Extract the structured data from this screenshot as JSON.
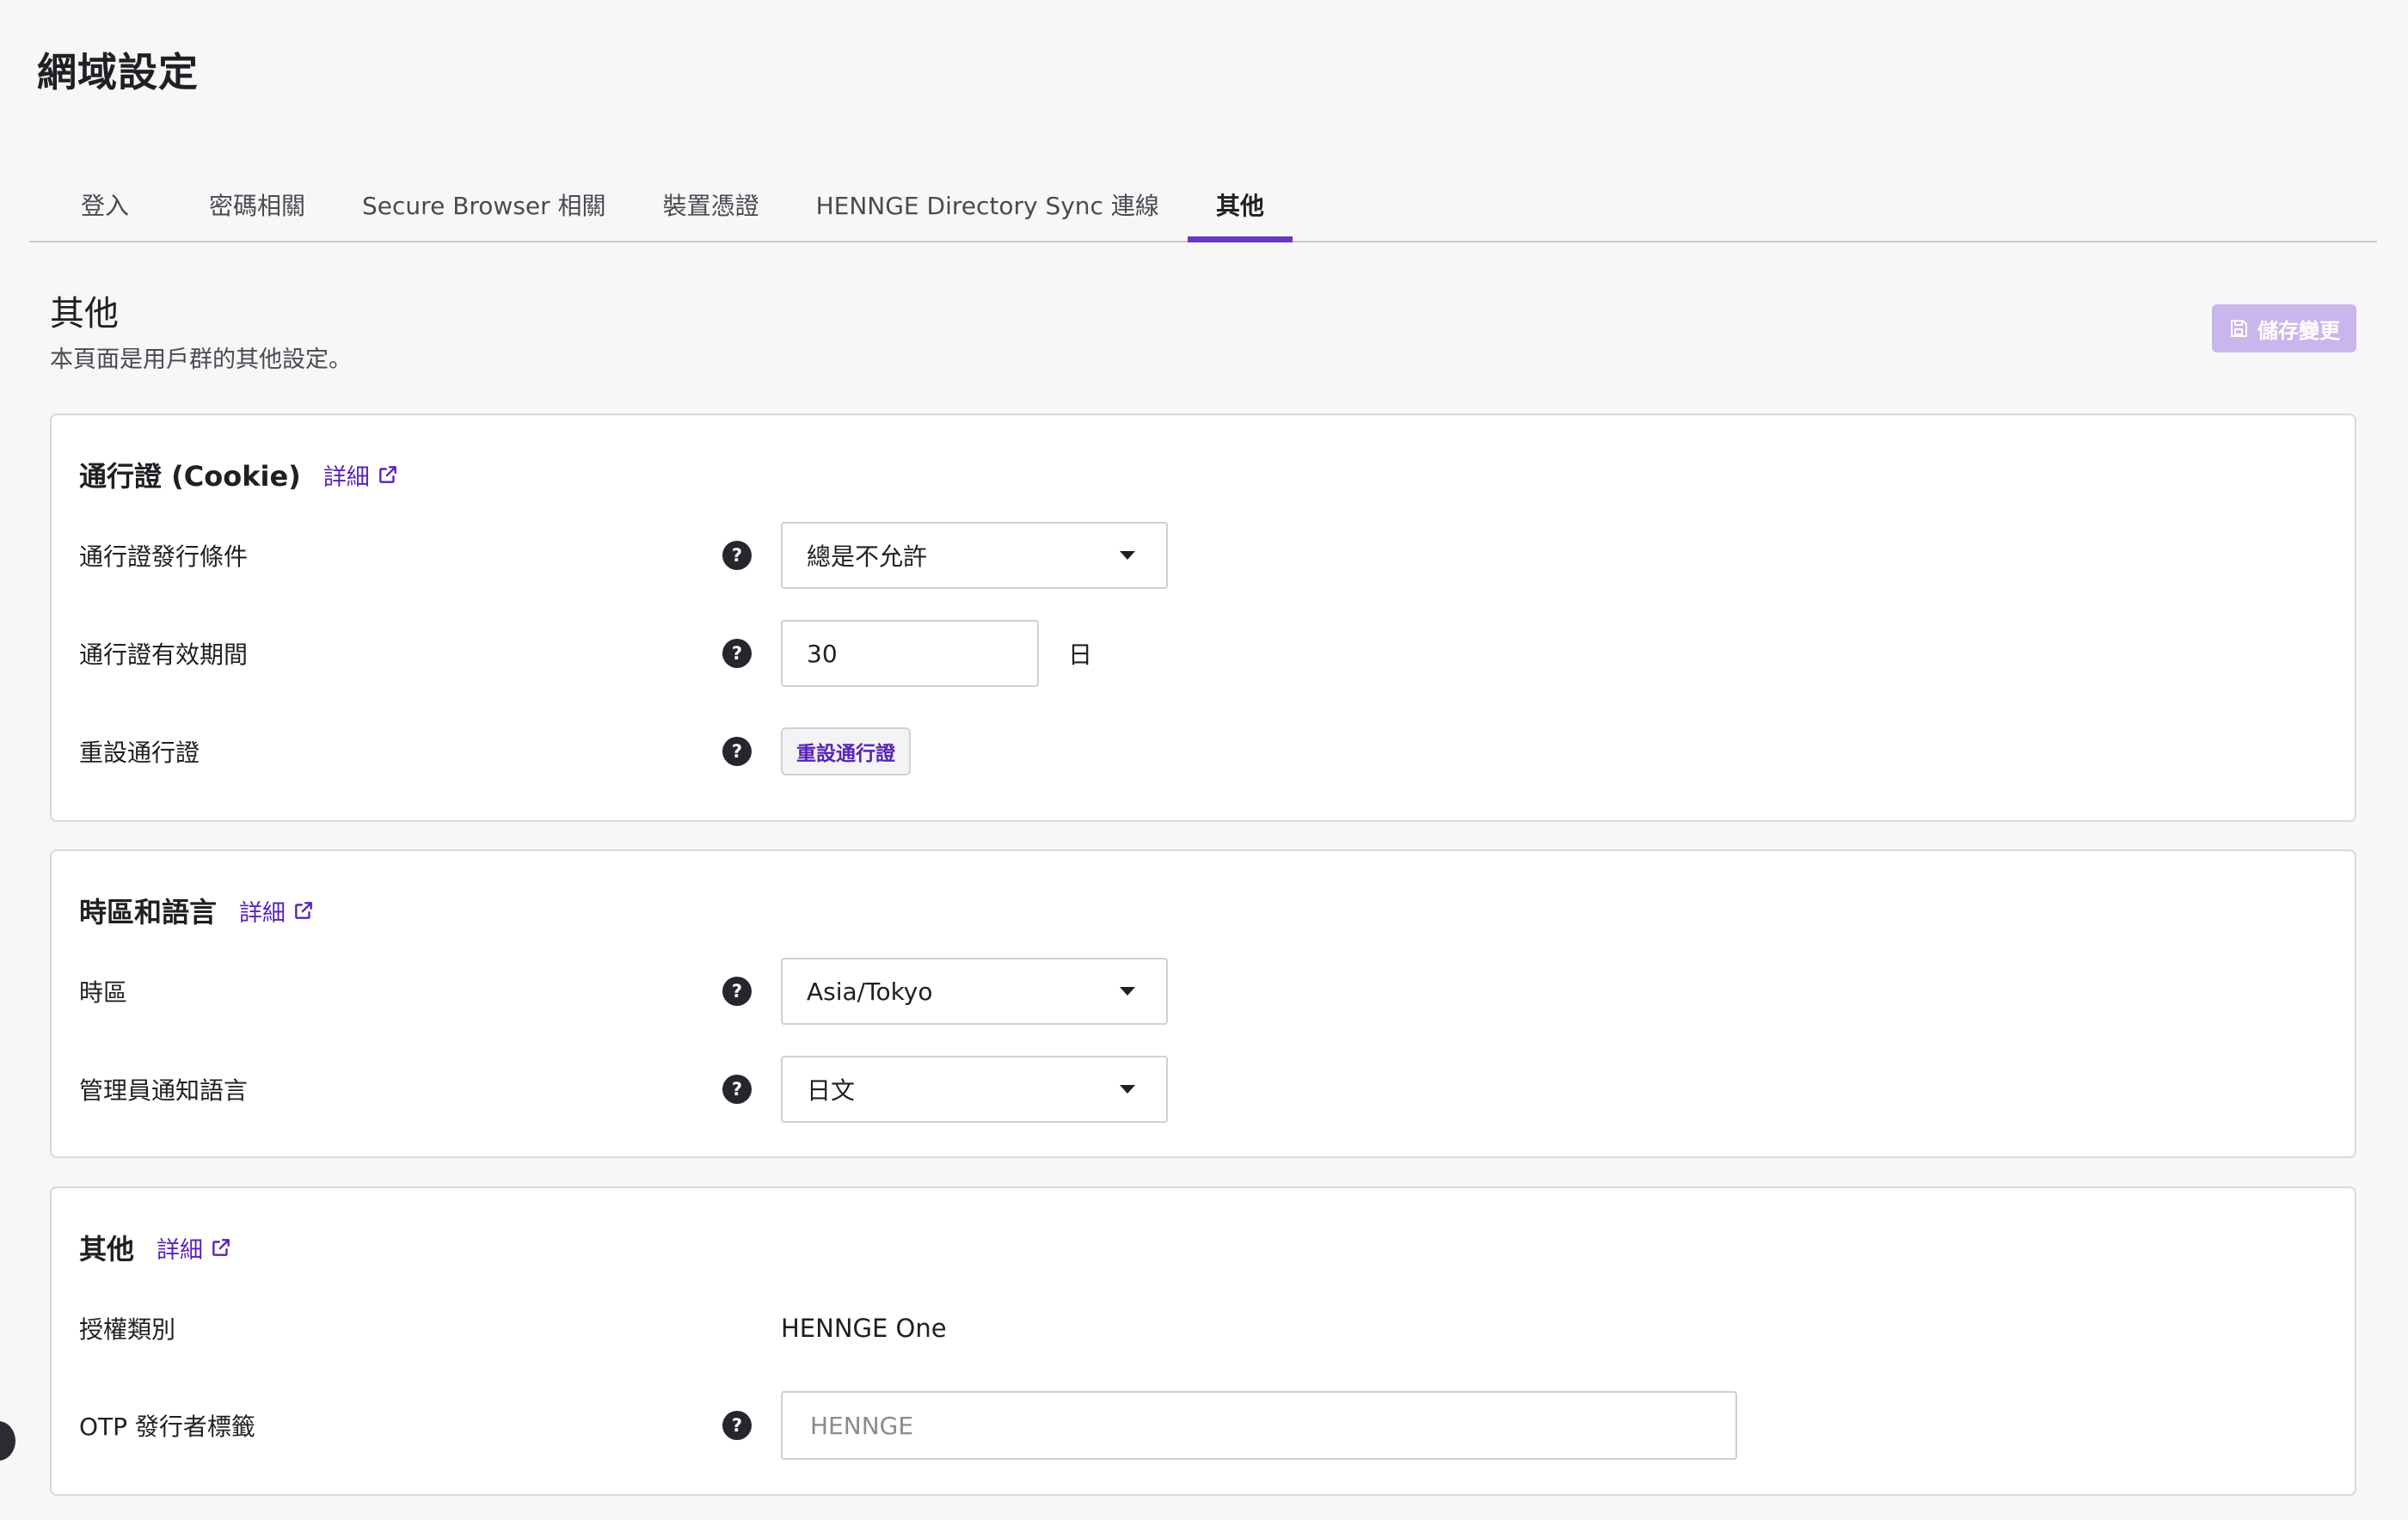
{
  "page": {
    "title": "網域設定"
  },
  "tabs": [
    {
      "label": "登入",
      "active": false
    },
    {
      "label": "密碼相關",
      "active": false
    },
    {
      "label": "Secure Browser 相關",
      "active": false
    },
    {
      "label": "裝置憑證",
      "active": false
    },
    {
      "label": "HENNGE Directory Sync 連線",
      "active": false
    },
    {
      "label": "其他",
      "active": true
    }
  ],
  "section": {
    "title": "其他",
    "subtitle": "本頁面是用戶群的其他設定。",
    "save_label": "儲存變更"
  },
  "cookie_card": {
    "title": "通行證 (Cookie)",
    "detail_label": "詳細",
    "issue_condition_label": "通行證發行條件",
    "issue_condition_value": "總是不允許",
    "validity_label": "通行證有效期間",
    "validity_value": "30",
    "validity_unit": "日",
    "reset_label": "重設通行證",
    "reset_button_label": "重設通行證"
  },
  "locale_card": {
    "title": "時區和語言",
    "detail_label": "詳細",
    "timezone_label": "時區",
    "timezone_value": "Asia/Tokyo",
    "admin_language_label": "管理員通知語言",
    "admin_language_value": "日文"
  },
  "other_card": {
    "title": "其他",
    "detail_label": "詳細",
    "license_label": "授權類別",
    "license_value": "HENNGE One",
    "otp_label": "OTP 發行者標籤",
    "otp_placeholder": "HENNGE"
  },
  "colors": {
    "accent": "#6b35c4",
    "link": "#5a22b8",
    "save_disabled": "#c8b6ec"
  },
  "icons": {
    "help": "question-circle-icon",
    "external": "external-link-icon",
    "save": "floppy-disk-icon",
    "dropdown": "caret-down-icon"
  }
}
